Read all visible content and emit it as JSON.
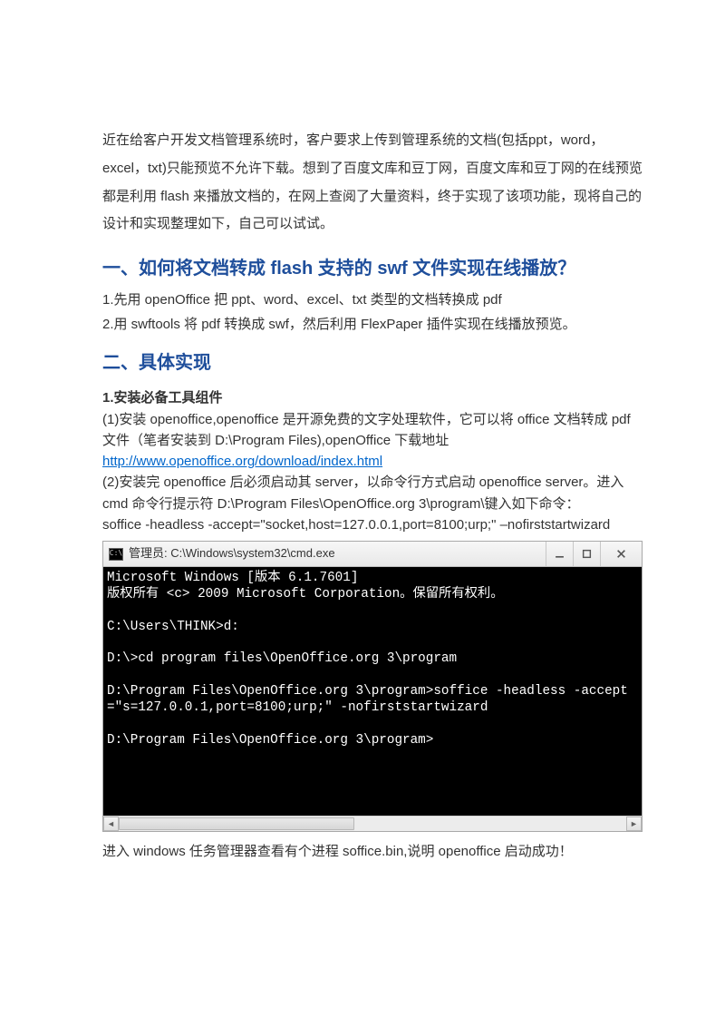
{
  "intro": "近在给客户开发文档管理系统时，客户要求上传到管理系统的文档(包括ppt，word，excel，txt)只能预览不允许下载。想到了百度文库和豆丁网，百度文库和豆丁网的在线预览都是利用 flash 来播放文档的，在网上查阅了大量资料，终于实现了该项功能，现将自己的设计和实现整理如下，自己可以试试。",
  "section1_heading": "一、如何将文档转成 flash 支持的 swf 文件实现在线播放？",
  "step1": "1.先用 openOffice 把 ppt、word、excel、txt 类型的文档转换成 pdf",
  "step2": "2.用 swftools 将 pdf 转换成 swf，然后利用 FlexPaper 插件实现在线播放预览。",
  "section2_heading": "二、具体实现",
  "sub_heading": "1.安装必备工具组件",
  "para1": "(1)安装 openoffice,openoffice 是开源免费的文字处理软件，它可以将 office 文档转成 pdf 文件（笔者安装到 D:\\Program Files),openOffice 下载地址",
  "download_link": "http://www.openoffice.org/download/index.html",
  "para2a": "(2)安装完 openoffice 后必须启动其 server，以命令行方式启动 openoffice server。进入 cmd 命令行提示符 D:\\Program Files\\OpenOffice.org 3\\program\\键入如下命令：",
  "para2b": "soffice -headless -accept=\"socket,host=127.0.0.1,port=8100;urp;\" –nofirststartwizard",
  "cmd": {
    "icon_text": "C:\\",
    "title": "管理员: C:\\Windows\\system32\\cmd.exe",
    "lines": "Microsoft Windows [版本 6.1.7601]\n版权所有 <c> 2009 Microsoft Corporation。保留所有权利。\n\nC:\\Users\\THINK>d:\n\nD:\\>cd program files\\OpenOffice.org 3\\program\n\nD:\\Program Files\\OpenOffice.org 3\\program>soffice -headless -accept=\"s=127.0.0.1,port=8100;urp;\" -nofirststartwizard\n\nD:\\Program Files\\OpenOffice.org 3\\program>\n\n\n\n\n"
  },
  "after_cmd": "进入 windows 任务管理器查看有个进程 soffice.bin,说明 openoffice 启动成功！"
}
